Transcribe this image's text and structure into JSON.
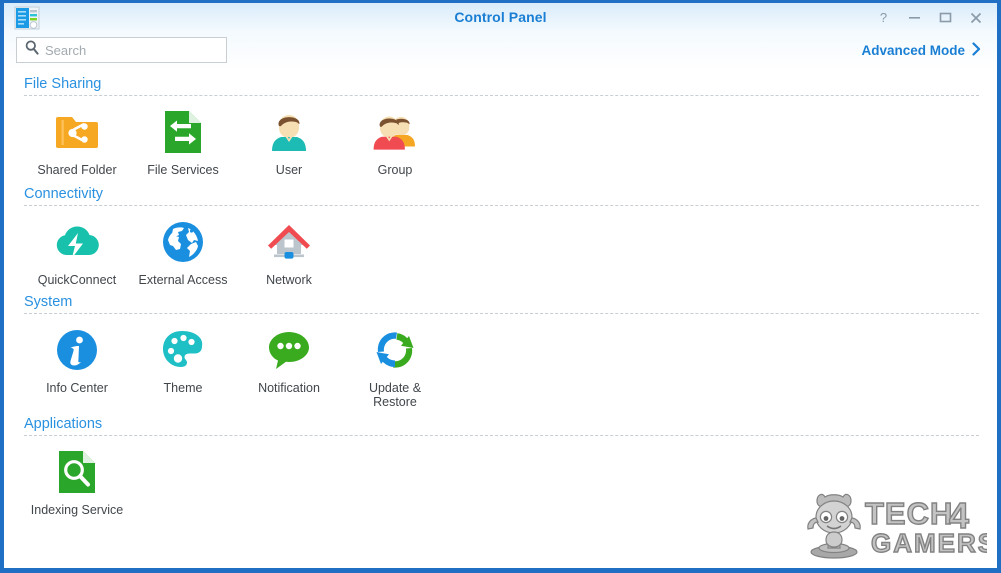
{
  "window": {
    "title": "Control Panel",
    "app_icon": "control-panel-icon",
    "border_color": "#1f6fc4",
    "title_color": "#1a7fd4",
    "controls": [
      {
        "name": "help-button",
        "glyph": "?"
      },
      {
        "name": "minimize-button",
        "glyph": "−"
      },
      {
        "name": "maximize-button",
        "glyph": "□"
      },
      {
        "name": "close-button",
        "glyph": "✕"
      }
    ]
  },
  "toolbar": {
    "search": {
      "icon": "search-icon",
      "placeholder": "Search",
      "value": ""
    },
    "advanced_mode": {
      "label": "Advanced Mode",
      "icon": "chevron-right-icon",
      "color": "#1a7fd4"
    }
  },
  "sections": [
    {
      "id": "file-sharing",
      "title": "File Sharing",
      "items": [
        {
          "id": "shared-folder",
          "label": "Shared Folder",
          "icon": "shared-folder-icon",
          "color": "#f5a623"
        },
        {
          "id": "file-services",
          "label": "File Services",
          "icon": "file-services-icon",
          "color": "#29a329"
        },
        {
          "id": "user",
          "label": "User",
          "icon": "user-icon",
          "color": "#1abcb4"
        },
        {
          "id": "group",
          "label": "Group",
          "icon": "group-icon",
          "color": "#ef4b51"
        }
      ]
    },
    {
      "id": "connectivity",
      "title": "Connectivity",
      "items": [
        {
          "id": "quickconnect",
          "label": "QuickConnect",
          "icon": "quickconnect-icon",
          "color": "#1fc2ab"
        },
        {
          "id": "external-access",
          "label": "External Access",
          "icon": "external-access-icon",
          "color": "#1d8fe0"
        },
        {
          "id": "network",
          "label": "Network",
          "icon": "network-icon",
          "color": "#ef4b51"
        }
      ]
    },
    {
      "id": "system",
      "title": "System",
      "items": [
        {
          "id": "info-center",
          "label": "Info Center",
          "icon": "info-center-icon",
          "color": "#1d8fe0"
        },
        {
          "id": "theme",
          "label": "Theme",
          "icon": "theme-icon",
          "color": "#1fbfc6"
        },
        {
          "id": "notification",
          "label": "Notification",
          "icon": "notification-icon",
          "color": "#3aab1e"
        },
        {
          "id": "update-restore",
          "label": "Update & Restore",
          "icon": "update-restore-icon",
          "color": "#1d8fe0"
        }
      ]
    },
    {
      "id": "applications",
      "title": "Applications",
      "items": [
        {
          "id": "indexing-service",
          "label": "Indexing Service",
          "icon": "indexing-service-icon",
          "color": "#3aab1e"
        }
      ]
    }
  ],
  "watermark": {
    "line1": "TECH 4",
    "line2": "GAMERS",
    "mascot": "mascot-icon"
  }
}
